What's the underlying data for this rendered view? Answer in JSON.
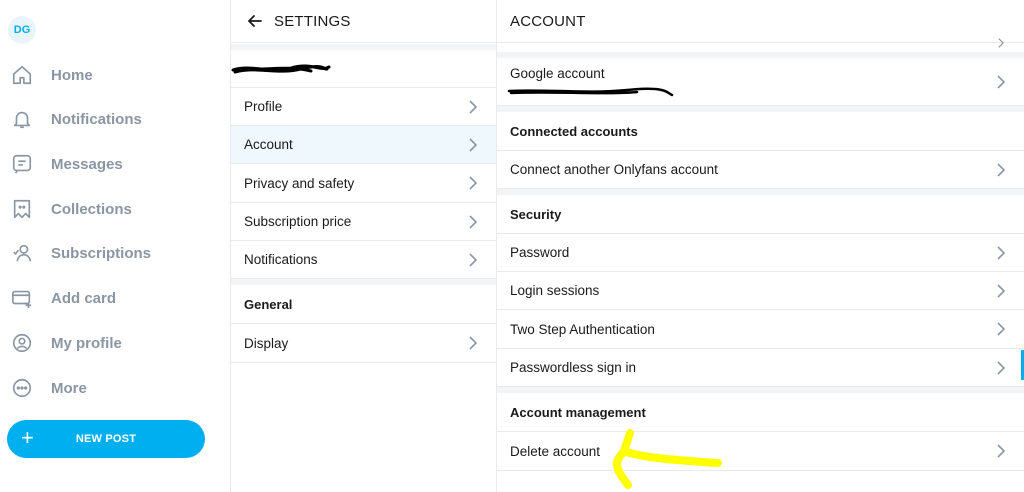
{
  "sidebar": {
    "avatar_initials": "DG",
    "nav": [
      {
        "label": "Home",
        "icon": "home-icon"
      },
      {
        "label": "Notifications",
        "icon": "bell-icon"
      },
      {
        "label": "Messages",
        "icon": "message-icon"
      },
      {
        "label": "Collections",
        "icon": "collections-icon"
      },
      {
        "label": "Subscriptions",
        "icon": "subscriptions-icon"
      },
      {
        "label": "Add card",
        "icon": "card-icon"
      },
      {
        "label": "My profile",
        "icon": "profile-icon"
      },
      {
        "label": "More",
        "icon": "more-icon"
      }
    ],
    "new_post_label": "NEW POST"
  },
  "settings": {
    "title": "SETTINGS",
    "items": [
      {
        "label": "Profile"
      },
      {
        "label": "Account"
      },
      {
        "label": "Privacy and safety"
      },
      {
        "label": "Subscription price"
      },
      {
        "label": "Notifications"
      }
    ],
    "general_section": "General",
    "general_items": [
      {
        "label": "Display"
      }
    ]
  },
  "account": {
    "title": "ACCOUNT",
    "google_account_label": "Google account",
    "connected_section": "Connected accounts",
    "connect_another": "Connect another Onlyfans account",
    "security_section": "Security",
    "security_items": [
      {
        "label": "Password"
      },
      {
        "label": "Login sessions"
      },
      {
        "label": "Two Step Authentication"
      },
      {
        "label": "Passwordless sign in"
      }
    ],
    "management_section": "Account management",
    "delete_account": "Delete account"
  },
  "colors": {
    "accent": "#00aff0",
    "muted_text": "#8a96a3",
    "annotation": "#ffff00"
  }
}
